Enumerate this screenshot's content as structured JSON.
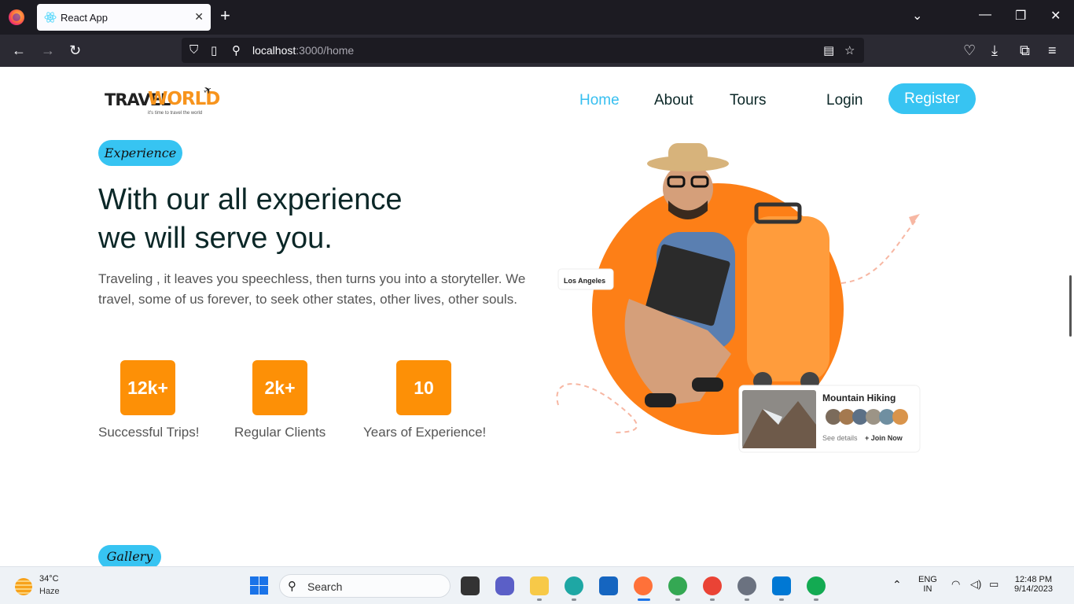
{
  "browser": {
    "tab_title": "React App",
    "tab_close": "✕",
    "new_tab": "+",
    "url_host": "localhost",
    "url_path": ":3000/home"
  },
  "site": {
    "logo_main": "TRAVEL",
    "logo_accent": "WORLD",
    "logo_tagline": "it's time to travel the world",
    "nav": [
      "Home",
      "About",
      "Tours"
    ],
    "login_label": "Login",
    "register_label": "Register"
  },
  "hero": {
    "pill_label": "Experience",
    "title_line1": "With our all experience",
    "title_line2": "we will serve you.",
    "description": "Traveling , it leaves you speechless, then turns you into a storyteller. We travel, some of us forever, to seek other states, other lives, other souls.",
    "stats": [
      {
        "value": "12k+",
        "label": "Successful Trips!"
      },
      {
        "value": "2k+",
        "label": "Regular Clients"
      },
      {
        "value": "10",
        "label": "Years of Experience!"
      }
    ],
    "card_location": "Los Angeles",
    "card_title": "Mountain Hiking",
    "card_link1": "See details",
    "card_link2": "+ Join Now"
  },
  "gallery": {
    "pill_label": "Gallery"
  },
  "taskbar": {
    "temp": "34°C",
    "weather": "Haze",
    "search_label": "Search",
    "lang1": "ENG",
    "lang2": "IN",
    "time": "12:48 PM",
    "date": "9/14/2023"
  },
  "colors": {
    "accent_blue": "#37c4f2",
    "accent_orange": "#fd9006",
    "heading": "#0b2727"
  }
}
